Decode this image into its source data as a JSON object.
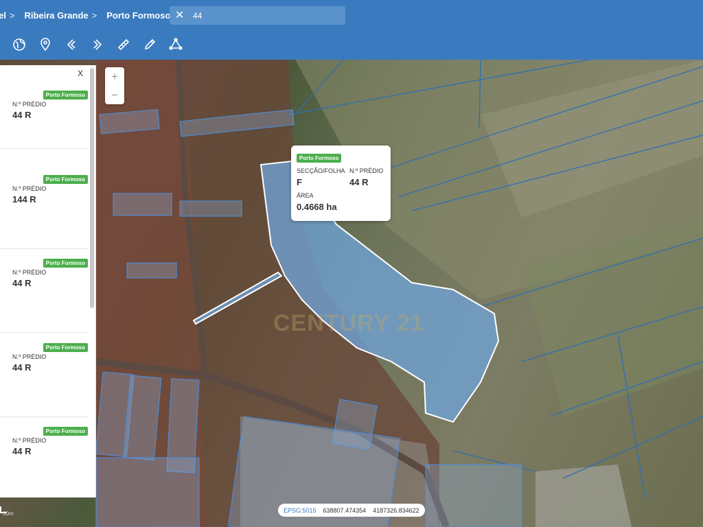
{
  "breadcrumb": {
    "items": [
      {
        "label": "el"
      },
      {
        "label": "Ribeira Grande"
      },
      {
        "label": "Porto Formoso"
      }
    ],
    "chevron": ">"
  },
  "search": {
    "value": "44",
    "clear_icon": "close-icon"
  },
  "toolbar": {
    "tools": [
      {
        "name": "globe-icon"
      },
      {
        "name": "map-pin-icon"
      },
      {
        "name": "back-icon"
      },
      {
        "name": "forward-icon"
      },
      {
        "name": "ruler-icon"
      },
      {
        "name": "pencil-icon"
      },
      {
        "name": "polygon-icon"
      }
    ]
  },
  "zoom": {
    "in": "+",
    "out": "−"
  },
  "panel": {
    "close": "X",
    "cards": [
      {
        "badge": "Porto Formoso",
        "label": "N.º PRÉDIO",
        "value": "44 R"
      },
      {
        "badge": "Porto Formoso",
        "label": "N.º PRÉDIO",
        "value": "144 R"
      },
      {
        "badge": "Porto Formoso",
        "label": "N.º PRÉDIO",
        "value": "44 R"
      },
      {
        "badge": "Porto Formoso",
        "label": "N.º PRÉDIO",
        "value": "44 R"
      },
      {
        "badge": "Porto Formoso",
        "label": "N.º PRÉDIO",
        "value": "44 R"
      }
    ]
  },
  "popup": {
    "badge": "Porto Formoso",
    "section_label": "SECÇÃO/FOLHA",
    "section_value": "F",
    "predio_label": "N.º PRÉDIO",
    "predio_value": "44 R",
    "area_label": "ÁREA",
    "area_value": "0.4668 ha"
  },
  "watermark": "CENTURY 21",
  "coordinates": {
    "epsg": "EPSG:5015",
    "x": "638807.474354",
    "y": "4187326.834622"
  },
  "scale": "30m",
  "colors": {
    "topbar": "#3a7bbf",
    "badge": "#4cae4c",
    "parcel_fill": "#6fa3d6",
    "parcel_line": "#2e6fb5"
  }
}
